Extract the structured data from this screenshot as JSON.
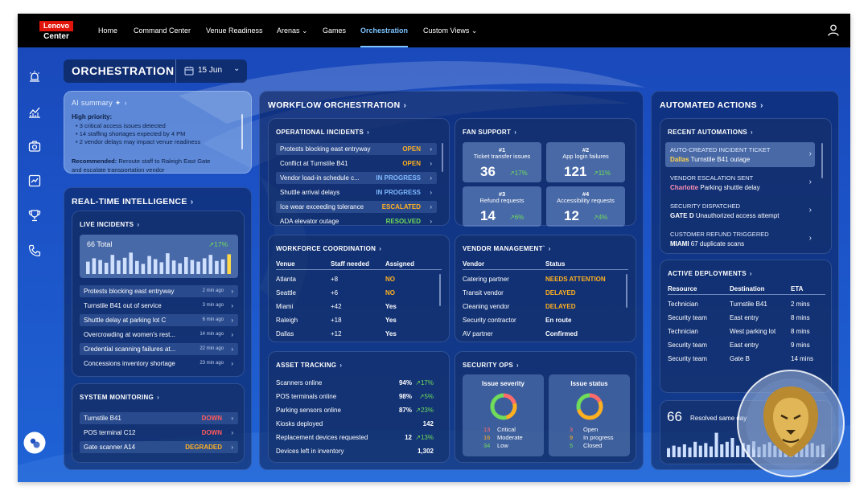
{
  "header": {
    "logo_top": "Lenovo",
    "logo_bottom": "Center",
    "nav": [
      {
        "label": "Home"
      },
      {
        "label": "Command Center"
      },
      {
        "label": "Venue Readiness"
      },
      {
        "label": "Arenas ⌄"
      },
      {
        "label": "Games"
      },
      {
        "label": "Orchestration"
      },
      {
        "label": "Custom Views ⌄"
      }
    ],
    "active_nav": "Orchestration"
  },
  "page": {
    "title": "ORCHESTRATION",
    "date": "15 Jun"
  },
  "ai_summary": {
    "title": "AI summary ✦",
    "high_label": "High priority:",
    "bullets": [
      "3 critical access issues detected",
      "14 staffing shortages expected by 4 PM",
      "2 vendor delays may impact venue readiness"
    ],
    "rec_label": "Recommended:",
    "rec_text": "Reroute staff to Raleigh East Gate",
    "rec_text2": "and escalate transportation vendor"
  },
  "realtime": {
    "title": "REAL-TIME INTELLIGENCE",
    "live": {
      "title": "LIVE INCIDENTS",
      "total_num": "66",
      "total_label": "Total",
      "change": "17%",
      "bars": [
        0.55,
        0.7,
        0.62,
        0.5,
        0.85,
        0.6,
        0.72,
        0.95,
        0.58,
        0.45,
        0.8,
        0.66,
        0.52,
        0.92,
        0.6,
        0.48,
        0.75,
        0.62,
        0.55,
        0.7,
        0.85,
        0.58,
        0.65,
        0.88
      ],
      "items": [
        {
          "label": "Protests blocking east entryway",
          "time": "2 min ago"
        },
        {
          "label": "Turnstile B41 out of service",
          "time": "3 min ago"
        },
        {
          "label": "Shuttle delay at parking lot C",
          "time": "6 min ago"
        },
        {
          "label": "Overcrowding at women's rest...",
          "time": "14 min ago"
        },
        {
          "label": "Credential scanning failures at...",
          "time": "22 min ago"
        },
        {
          "label": "Concessions inventory shortage",
          "time": "23 min ago"
        }
      ]
    },
    "system": {
      "title": "SYSTEM MONITORING",
      "items": [
        {
          "label": "Turnstile B41",
          "status": "DOWN"
        },
        {
          "label": "POS terminal C12",
          "status": "DOWN"
        },
        {
          "label": "Gate scanner A14",
          "status": "DEGRADED"
        }
      ]
    }
  },
  "workflow": {
    "title": "WORKFLOW ORCHESTRATION",
    "incidents": {
      "title": "OPERATIONAL INCIDENTS",
      "items": [
        {
          "label": "Protests blocking east entryway",
          "status": "OPEN"
        },
        {
          "label": "Conflict at Turnstile B41",
          "status": "OPEN"
        },
        {
          "label": "Vendor load-in schedule c...",
          "status": "IN PROGRESS"
        },
        {
          "label": "Shuttle arrival delays",
          "status": "IN PROGRESS"
        },
        {
          "label": "Ice wear exceeding tolerance",
          "status": "ESCALATED"
        },
        {
          "label": "ADA elevator outage",
          "status": "RESOLVED"
        }
      ]
    },
    "fan": {
      "title": "FAN SUPPORT",
      "cards": [
        {
          "rank": "#1",
          "label": "Ticket transfer issues",
          "value": "36",
          "change": "17%"
        },
        {
          "rank": "#2",
          "label": "App login failures",
          "value": "121",
          "change": "11%"
        },
        {
          "rank": "#3",
          "label": "Refund requests",
          "value": "14",
          "change": "6%"
        },
        {
          "rank": "#4",
          "label": "Accessibility requests",
          "value": "12",
          "change": "4%"
        }
      ]
    },
    "workforce": {
      "title": "WORKFORCE COORDINATION",
      "headers": [
        "Venue",
        "Staff needed",
        "Assigned"
      ],
      "rows": [
        [
          "Atlanta",
          "+8",
          "NO"
        ],
        [
          "Seattle",
          "+6",
          "NO"
        ],
        [
          "Miami",
          "+42",
          "Yes"
        ],
        [
          "Raleigh",
          "+18",
          "Yes"
        ],
        [
          "Dallas",
          "+12",
          "Yes"
        ]
      ]
    },
    "vendor": {
      "title": "VENDOR MANAGEMENT`",
      "headers": [
        "Vendor",
        "Status"
      ],
      "rows": [
        [
          "Catering partner",
          "NEEDS ATTENTION"
        ],
        [
          "Transit vendor",
          "DELAYED"
        ],
        [
          "Cleaning vendor",
          "DELAYED"
        ],
        [
          "Security contractor",
          "En route"
        ],
        [
          "AV partner",
          "Confirmed"
        ]
      ]
    },
    "asset": {
      "title": "ASSET TRACKING",
      "rows": [
        {
          "label": "Scanners online",
          "value": "94%",
          "change": "17%"
        },
        {
          "label": "POS terminals online",
          "value": "98%",
          "change": "5%"
        },
        {
          "label": "Parking sensors online",
          "value": "87%",
          "change": "23%"
        },
        {
          "label": "Kiosks deployed",
          "value": "142",
          "change": ""
        },
        {
          "label": "Replacement devices requested",
          "value": "12",
          "change": "13%"
        },
        {
          "label": "Devices left in inventory",
          "value": "1,302",
          "change": ""
        }
      ]
    },
    "security": {
      "title": "SECURITY OPS",
      "severity": {
        "title": "Issue severity",
        "items": [
          {
            "num": "13",
            "label": "Critical",
            "color": "#ff6b6b"
          },
          {
            "num": "16",
            "label": "Moderate",
            "color": "#ffb020"
          },
          {
            "num": "34",
            "label": "Low",
            "color": "#6fdc5a"
          }
        ]
      },
      "status": {
        "title": "Issue status",
        "items": [
          {
            "num": "3",
            "label": "Open",
            "color": "#ff6b6b"
          },
          {
            "num": "9",
            "label": "In progress",
            "color": "#ffb020"
          },
          {
            "num": "5",
            "label": "Closed",
            "color": "#6fdc5a"
          }
        ]
      }
    }
  },
  "automated": {
    "title": "AUTOMATED ACTIONS",
    "recent": {
      "title": "RECENT AUTOMATIONS",
      "items": [
        {
          "title": "AUTO-CREATED INCIDENT TICKET",
          "city": "Dallas",
          "detail": "Turnstile B41 outage"
        },
        {
          "title": "VENDOR ESCALATION SENT",
          "city": "Charlotte",
          "detail": "Parking shuttle delay"
        },
        {
          "title": "SECURITY DISPATCHED",
          "city": "GATE D",
          "detail": "Unauthorized access attempt"
        },
        {
          "title": "CUSTOMER REFUND TRIGGERED",
          "city": "MIAMI",
          "detail": "67 duplicate scans"
        }
      ]
    },
    "deploy": {
      "title": "ACTIVE DEPLOYMENTS",
      "headers": [
        "Resource",
        "Destination",
        "ETA"
      ],
      "rows": [
        [
          "Technician",
          "Turnstile B41",
          "2 mins"
        ],
        [
          "Security team",
          "East entry",
          "8 mins"
        ],
        [
          "Technician",
          "West parking lot",
          "8 mins"
        ],
        [
          "Security team",
          "East entry",
          "9 mins"
        ],
        [
          "Security team",
          "Gate B",
          "14 mins"
        ]
      ]
    },
    "resolved": {
      "num": "66",
      "label": "Resolved same day",
      "bars": [
        0.35,
        0.45,
        0.4,
        0.5,
        0.38,
        0.6,
        0.45,
        0.55,
        0.42,
        0.95,
        0.5,
        0.6,
        0.75,
        0.45,
        0.55,
        0.48,
        0.62,
        0.4,
        0.5,
        0.58,
        0.45,
        0.65,
        0.5,
        0.55,
        0.48,
        0.6,
        0.5,
        0.55,
        0.45,
        0.5
      ]
    }
  }
}
